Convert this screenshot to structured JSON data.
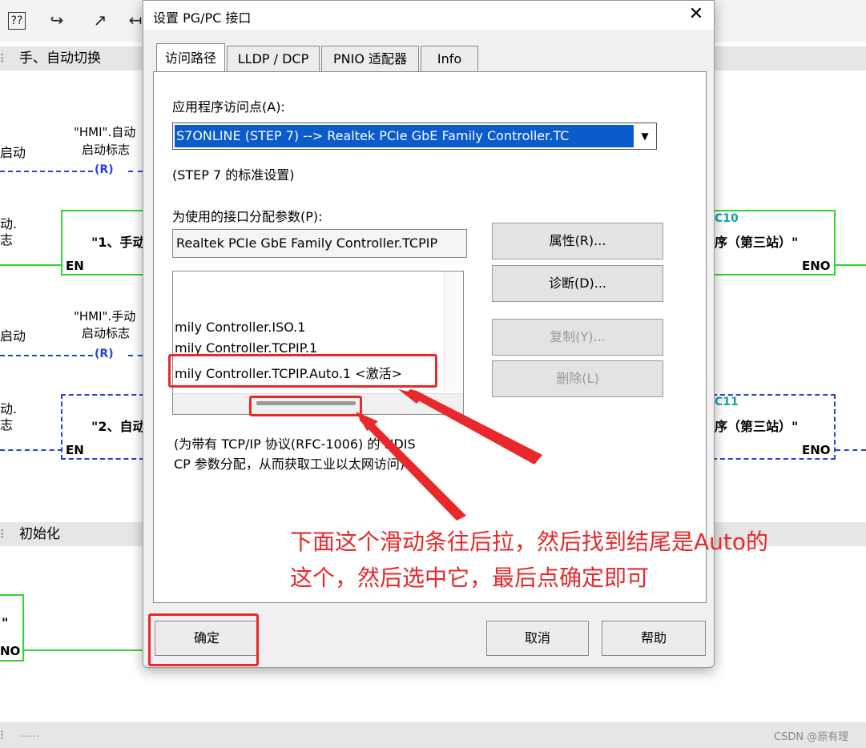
{
  "background": {
    "network_title_1": "手、自动切换",
    "network_title_2": "初始化",
    "footer_dots": "......",
    "rung1": {
      "left_label": "启动",
      "contact_tag_line1": "\"HMI\".自动",
      "contact_tag_line2": "启动标志",
      "coil": "R",
      "fb_left_frag_1": "动.",
      "fb_left_frag_2": "志",
      "fb_title": "\"1、手动",
      "fb_en": "EN",
      "fb_right_instance": "C10",
      "fb_right_title": "序（第三站）\"",
      "fb_eno": "ENO"
    },
    "rung2": {
      "left_label": "启动",
      "contact_tag_line1": "\"HMI\".手动",
      "contact_tag_line2": "启动标志",
      "coil": "R",
      "fb_left_frag_1": "动.",
      "fb_left_frag_2": "志",
      "fb_title": "\"2、自动",
      "fb_en": "EN",
      "fb_right_instance": "C11",
      "fb_right_title": "序（第三站）\"",
      "fb_eno": "ENO"
    },
    "rung3": {
      "fb_quote": "\"",
      "fb_eno": "NO"
    },
    "colors": {
      "accent_green": "#31d631",
      "dashed_blue": "#2a3fd6",
      "annotation_red": "#e8282a"
    }
  },
  "dialog": {
    "title": "设置 PG/PC 接口",
    "close_icon": "close-icon",
    "tabs": [
      {
        "label": "访问路径",
        "active": true
      },
      {
        "label": "LLDP / DCP",
        "active": false
      },
      {
        "label": "PNIO 适配器",
        "active": false
      },
      {
        "label": "Info",
        "active": false
      }
    ],
    "access_point_label": "应用程序访问点(A):",
    "access_point_value": "S7ONLINE (STEP 7)       --> Realtek PCIe GbE Family Controller.TC",
    "standard_note": "(STEP 7 的标准设置)",
    "params_label": "为使用的接口分配参数(P):",
    "params_value": "Realtek PCIe GbE Family Controller.TCPIP",
    "interface_list": [
      "mily Controller.ISO.1",
      "mily Controller.TCPIP.1",
      "mily Controller.TCPIP.Auto.1  <激活>"
    ],
    "buttons": {
      "properties": "属性(R)...",
      "diagnose": "诊断(D)...",
      "copy": "复制(Y)...",
      "delete": "删除(L)",
      "ok": "确定",
      "cancel": "取消",
      "help": "帮助"
    },
    "description_line1": "(为带有 TCP/IP 协议(RFC-1006) 的 NDIS",
    "description_line2": "CP 参数分配，从而获取工业以太网访问)"
  },
  "annotation": {
    "line1": "下面这个滑动条往后拉，然后找到结尾是Auto的",
    "line2": "这个，然后选中它，最后点确定即可"
  },
  "watermark": "CSDN @原有理"
}
